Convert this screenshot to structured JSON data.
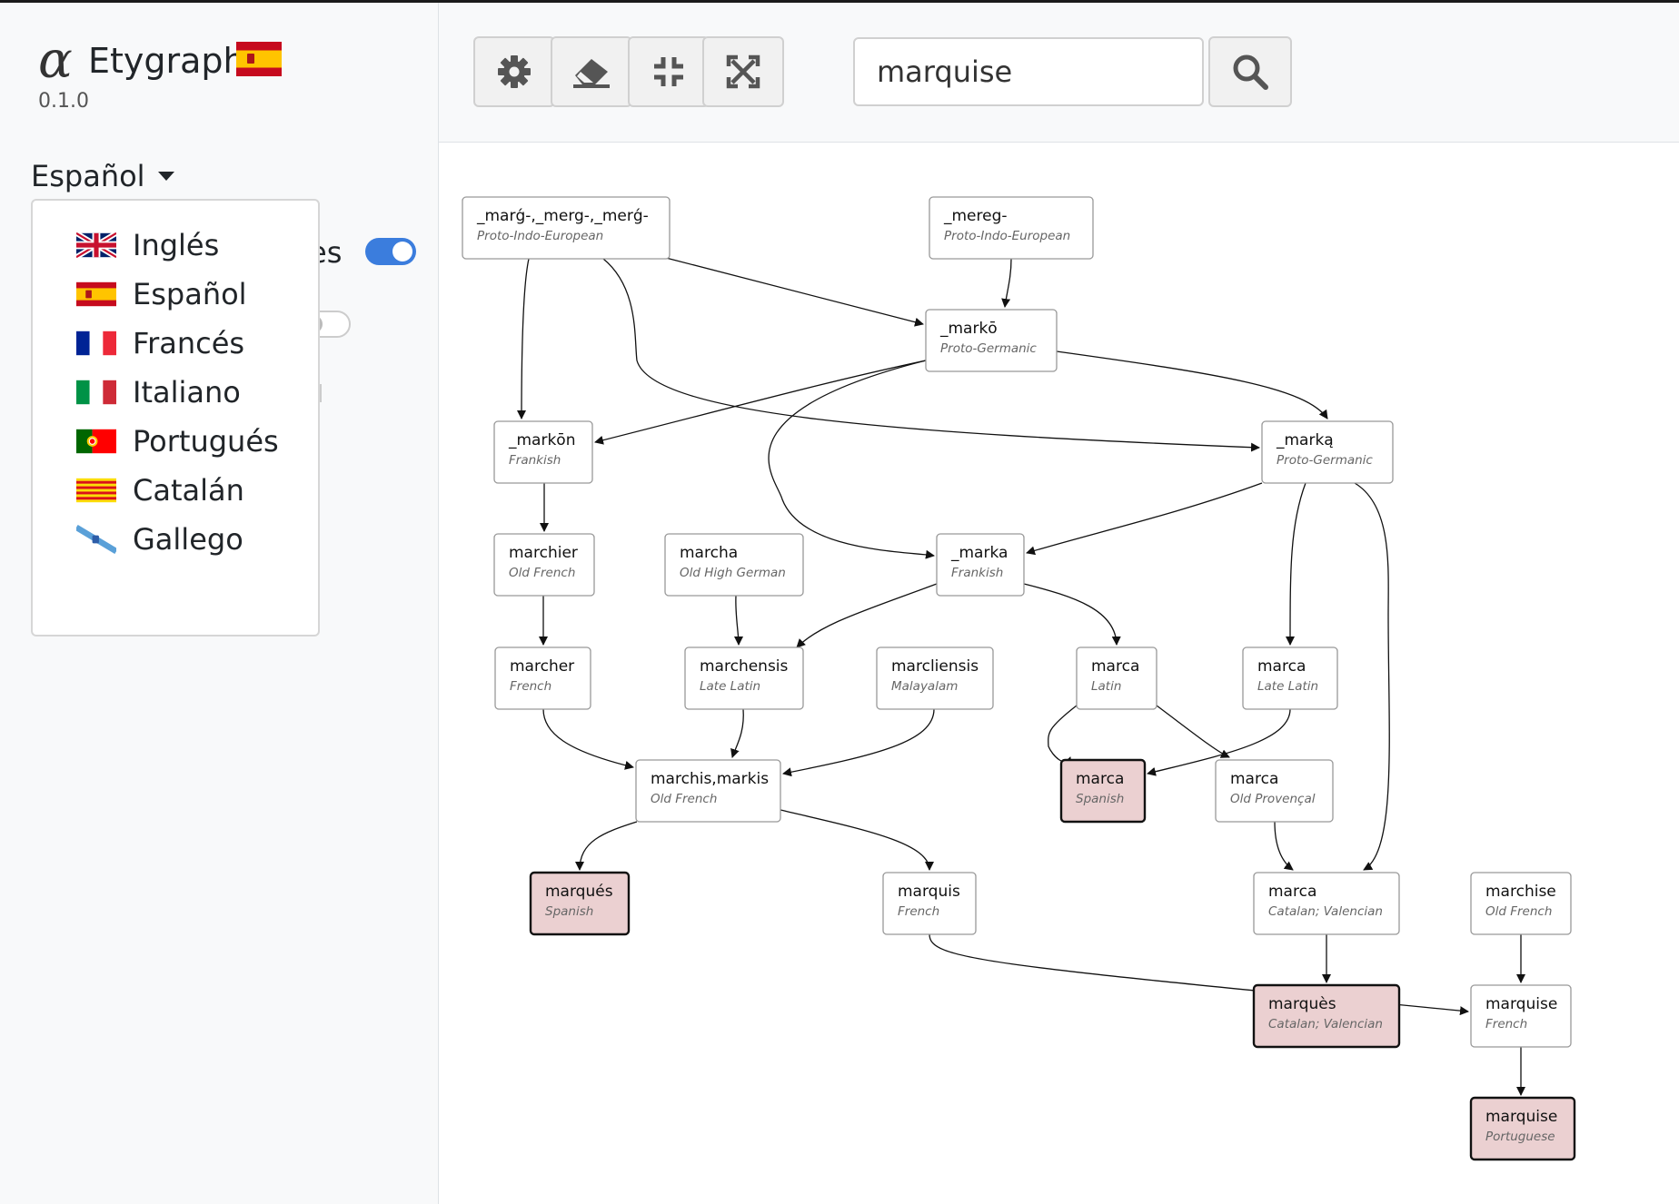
{
  "app": {
    "logo_glyph": "α",
    "title": "Etygraph",
    "version": "0.1.0",
    "current_language": "Español",
    "option_label_fragment": "es"
  },
  "language_menu": [
    {
      "label": "Inglés",
      "flag": "uk-flag-icon"
    },
    {
      "label": "Español",
      "flag": "spain-flag-icon"
    },
    {
      "label": "Francés",
      "flag": "france-flag-icon"
    },
    {
      "label": "Italiano",
      "flag": "italy-flag-icon"
    },
    {
      "label": "Portugués",
      "flag": "portugal-flag-icon"
    },
    {
      "label": "Catalán",
      "flag": "catalonia-flag-icon"
    },
    {
      "label": "Gallego",
      "flag": "galicia-flag-icon"
    }
  ],
  "toolbar": {
    "buttons": [
      "gear-icon",
      "eraser-icon",
      "compress-icon",
      "expand-icon"
    ],
    "search_value": "marquise",
    "search_icon": "search-icon"
  },
  "colors": {
    "accent": "#3b7ddd",
    "highlight_fill": "#ebd0d1",
    "node_border": "#999999"
  },
  "graph": {
    "nodes": [
      {
        "id": "n1",
        "word": "_marǵ-,_merg-,_merǵ-",
        "lang": "Proto-Indo-European",
        "highlight": false
      },
      {
        "id": "n2",
        "word": "_mereg-",
        "lang": "Proto-Indo-European",
        "highlight": false
      },
      {
        "id": "n3",
        "word": "_markō",
        "lang": "Proto-Germanic",
        "highlight": false
      },
      {
        "id": "n4",
        "word": "_markōn",
        "lang": "Frankish",
        "highlight": false
      },
      {
        "id": "n5",
        "word": "_marką",
        "lang": "Proto-Germanic",
        "highlight": false
      },
      {
        "id": "n6",
        "word": "marchier",
        "lang": "Old French",
        "highlight": false
      },
      {
        "id": "n7",
        "word": "marcha",
        "lang": "Old High German",
        "highlight": false
      },
      {
        "id": "n8",
        "word": "_marka",
        "lang": "Frankish",
        "highlight": false
      },
      {
        "id": "n9",
        "word": "marcher",
        "lang": "French",
        "highlight": false
      },
      {
        "id": "n10",
        "word": "marchensis",
        "lang": "Late Latin",
        "highlight": false
      },
      {
        "id": "n11",
        "word": "marcliensis",
        "lang": "Malayalam",
        "highlight": false
      },
      {
        "id": "n12",
        "word": "marca",
        "lang": "Latin",
        "highlight": false
      },
      {
        "id": "n13",
        "word": "marca",
        "lang": "Late Latin",
        "highlight": false
      },
      {
        "id": "n14",
        "word": "marchis,markis",
        "lang": "Old French",
        "highlight": false
      },
      {
        "id": "n15",
        "word": "marca",
        "lang": "Spanish",
        "highlight": true
      },
      {
        "id": "n16",
        "word": "marca",
        "lang": "Old Provençal",
        "highlight": false
      },
      {
        "id": "n17",
        "word": "marqués",
        "lang": "Spanish",
        "highlight": true
      },
      {
        "id": "n18",
        "word": "marquis",
        "lang": "French",
        "highlight": false
      },
      {
        "id": "n19",
        "word": "marca",
        "lang": "Catalan; Valencian",
        "highlight": false
      },
      {
        "id": "n20",
        "word": "marchise",
        "lang": "Old French",
        "highlight": false
      },
      {
        "id": "n21",
        "word": "marquès",
        "lang": "Catalan; Valencian",
        "highlight": true
      },
      {
        "id": "n22",
        "word": "marquise",
        "lang": "French",
        "highlight": false
      },
      {
        "id": "n23",
        "word": "marquise",
        "lang": "Portuguese",
        "highlight": true
      }
    ],
    "edges": [
      [
        "n1",
        "n4"
      ],
      [
        "n1",
        "n3"
      ],
      [
        "n1",
        "n5"
      ],
      [
        "n2",
        "n3"
      ],
      [
        "n3",
        "n4"
      ],
      [
        "n3",
        "n8"
      ],
      [
        "n3",
        "n5"
      ],
      [
        "n4",
        "n6"
      ],
      [
        "n5",
        "n8"
      ],
      [
        "n5",
        "n13"
      ],
      [
        "n5",
        "n19"
      ],
      [
        "n6",
        "n9"
      ],
      [
        "n7",
        "n10"
      ],
      [
        "n8",
        "n10"
      ],
      [
        "n8",
        "n12"
      ],
      [
        "n9",
        "n14"
      ],
      [
        "n10",
        "n14"
      ],
      [
        "n11",
        "n14"
      ],
      [
        "n12",
        "n15"
      ],
      [
        "n12",
        "n16"
      ],
      [
        "n13",
        "n15"
      ],
      [
        "n14",
        "n17"
      ],
      [
        "n14",
        "n18"
      ],
      [
        "n16",
        "n19"
      ],
      [
        "n18",
        "n22"
      ],
      [
        "n19",
        "n21"
      ],
      [
        "n20",
        "n22"
      ],
      [
        "n22",
        "n23"
      ]
    ]
  }
}
